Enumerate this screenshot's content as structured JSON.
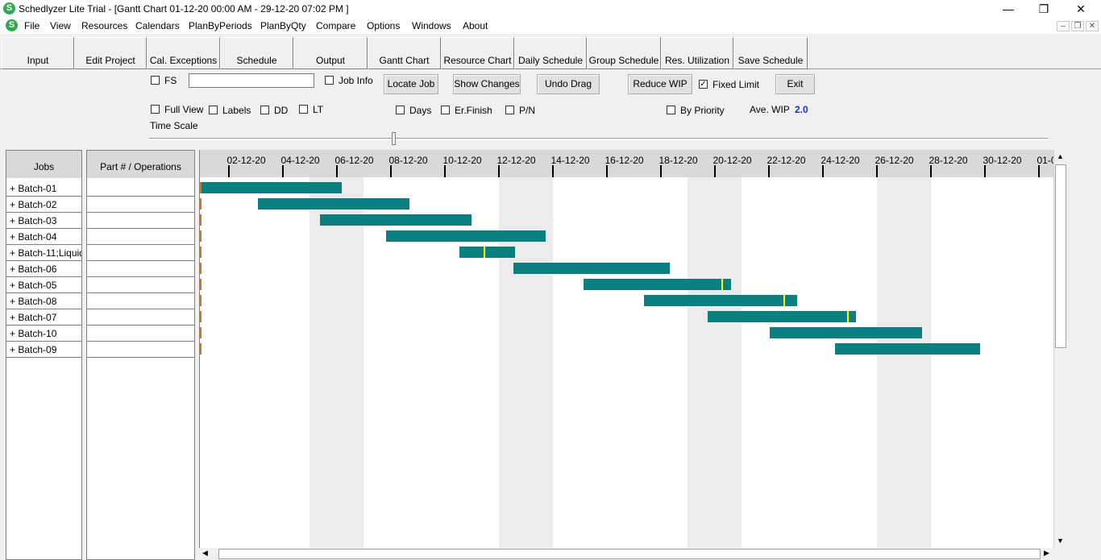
{
  "window": {
    "title": "Schedlyzer Lite Trial - [Gantt Chart   01-12-20 00:00 AM  -  29-12-20 07:02 PM ]",
    "app_icon": "S",
    "controls": {
      "minimize": "—",
      "restore": "❐",
      "close": "✕"
    }
  },
  "menu": {
    "items": [
      "File",
      "View",
      "Resources",
      "Calendars",
      "PlanByPeriods",
      "PlanByQty",
      "Compare",
      "Options",
      "Windows",
      "About"
    ],
    "mdi_controls": {
      "minimize": "–",
      "restore": "❐",
      "close": "✕"
    }
  },
  "tabs": [
    "Input",
    "Edit Project",
    "Cal. Exceptions",
    "Schedule",
    "Output",
    "Gantt Chart",
    "Resource Chart",
    "Daily Schedule",
    "Group Schedule",
    "Res. Utilization",
    "Save Schedule"
  ],
  "toolbar": {
    "fs": {
      "label": "FS",
      "checked": false
    },
    "search_value": "",
    "job_info": {
      "label": "Job Info",
      "checked": false
    },
    "locate_job": "Locate Job",
    "show_changes": "Show Changes",
    "undo_drag": "Undo Drag",
    "reduce_wip": "Reduce WIP",
    "fixed_limit": {
      "label": "Fixed Limit",
      "checked": true
    },
    "exit": "Exit",
    "full_view": {
      "label": "Full View",
      "checked": false
    },
    "labels": {
      "label": "Labels",
      "checked": false
    },
    "dd": {
      "label": "DD",
      "checked": false
    },
    "lt": {
      "label": "LT",
      "checked": false
    },
    "days": {
      "label": "Days",
      "checked": false
    },
    "er_finish": {
      "label": "Er.Finish",
      "checked": false
    },
    "pn": {
      "label": "P/N",
      "checked": false
    },
    "by_priority": {
      "label": "By Priority",
      "checked": false
    },
    "ave_wip_label": "Ave. WIP",
    "ave_wip_value": "2.0",
    "time_scale_label": "Time Scale",
    "time_scale_level": 0.27
  },
  "jobs_panel": {
    "header": "Jobs",
    "jobs": [
      "+  Batch-01",
      "+  Batch-02",
      "+  Batch-03",
      "+  Batch-04",
      "+  Batch-11;Liquid",
      "+  Batch-06",
      "+  Batch-05",
      "+  Batch-08",
      "+  Batch-07",
      "+  Batch-10",
      "+  Batch-09"
    ]
  },
  "parts_panel": {
    "header": "Part # / Operations"
  },
  "gantt": {
    "dates": [
      "02-12-20",
      "04-12-20",
      "06-12-20",
      "08-12-20",
      "10-12-20",
      "12-12-20",
      "14-12-20",
      "16-12-20",
      "18-12-20",
      "20-12-20",
      "22-12-20",
      "24-12-20",
      "26-12-20",
      "28-12-20",
      "30-12-20",
      "01-01-21"
    ],
    "bar_color": "#0a8080",
    "marker_color": "#ffff00",
    "weekend_color": "#ececec",
    "bars": [
      {
        "job": "Batch-01",
        "start_day": 0.0,
        "end_day": 5.2,
        "marker_day": null
      },
      {
        "job": "Batch-02",
        "start_day": 2.1,
        "end_day": 7.7,
        "marker_day": null
      },
      {
        "job": "Batch-03",
        "start_day": 4.4,
        "end_day": 10.0,
        "marker_day": null
      },
      {
        "job": "Batch-04",
        "start_day": 6.85,
        "end_day": 12.75,
        "marker_day": null
      },
      {
        "job": "Batch-11;Liquid",
        "start_day": 9.55,
        "end_day": 11.6,
        "marker_day": 10.45
      },
      {
        "job": "Batch-06",
        "start_day": 11.55,
        "end_day": 17.35,
        "marker_day": null
      },
      {
        "job": "Batch-05",
        "start_day": 14.15,
        "end_day": 19.6,
        "marker_day": 19.25
      },
      {
        "job": "Batch-08",
        "start_day": 16.4,
        "end_day": 22.05,
        "marker_day": 21.55
      },
      {
        "job": "Batch-07",
        "start_day": 18.75,
        "end_day": 24.25,
        "marker_day": 23.9
      },
      {
        "job": "Batch-10",
        "start_day": 21.05,
        "end_day": 26.7,
        "marker_day": null
      },
      {
        "job": "Batch-09",
        "start_day": 23.45,
        "end_day": 28.85,
        "marker_day": null
      }
    ],
    "weekends_start_day": [
      4,
      11,
      18,
      25
    ]
  }
}
